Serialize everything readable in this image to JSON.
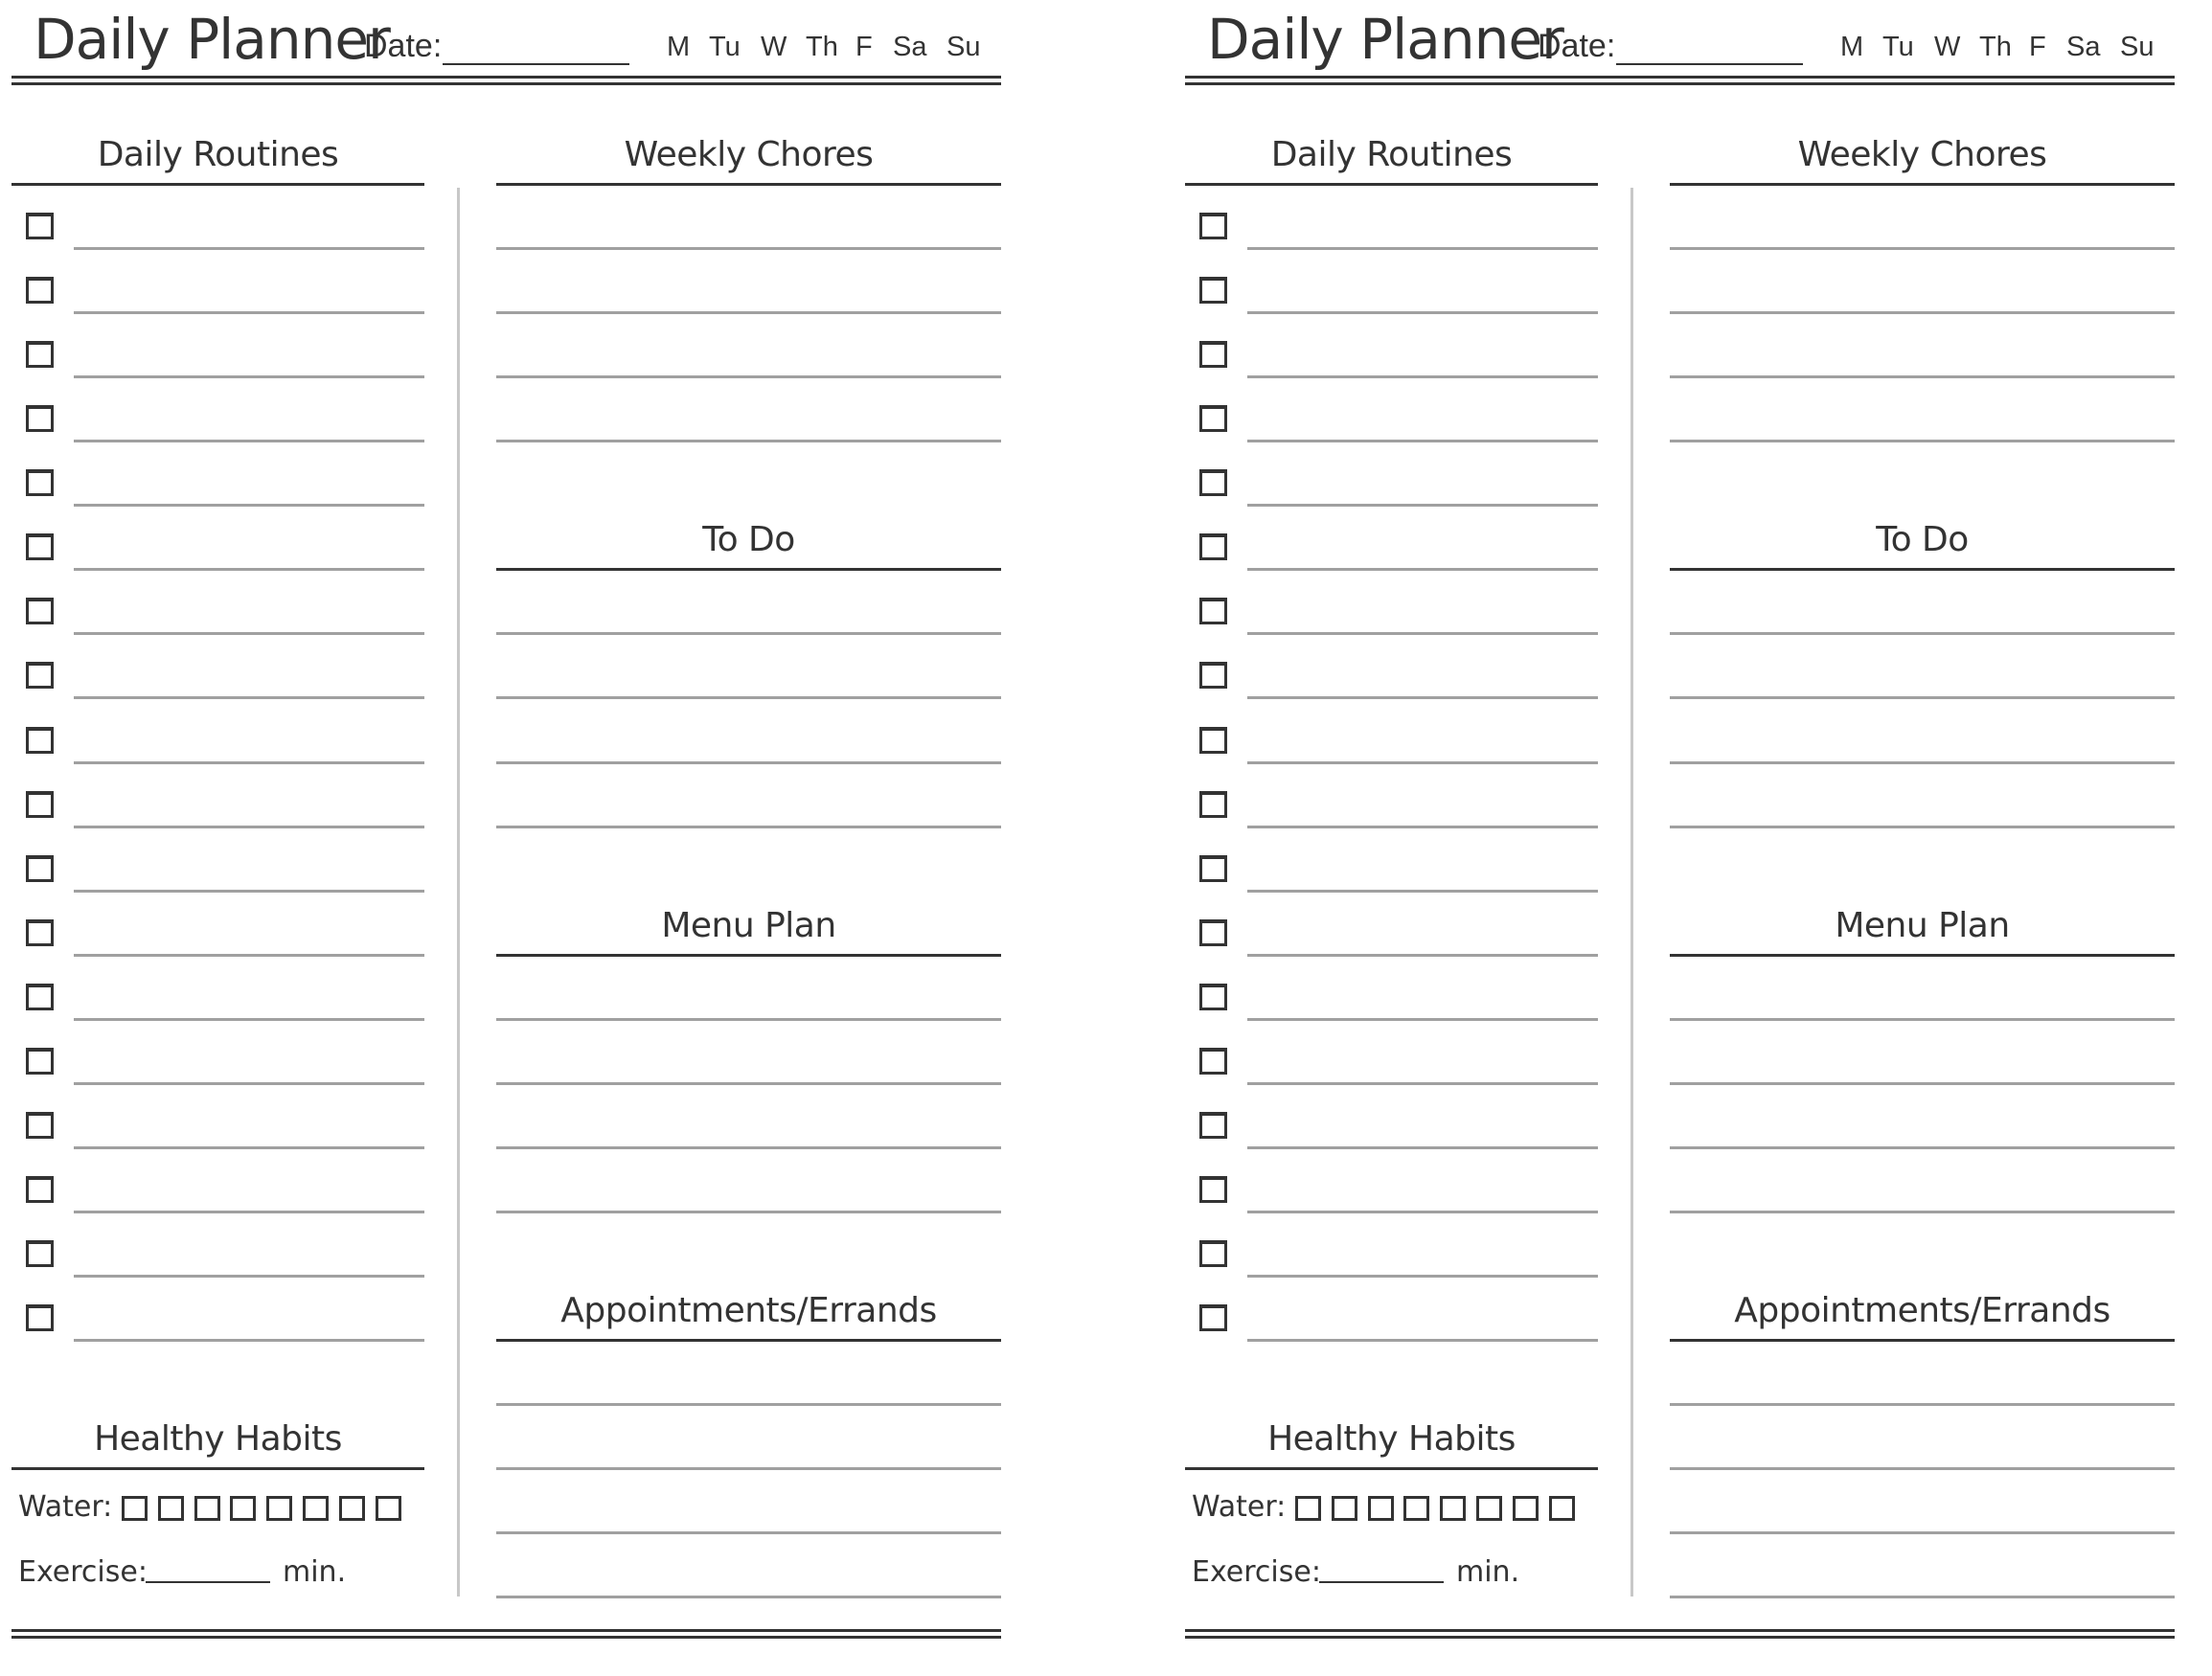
{
  "document": {
    "panels": [
      {
        "title": "Daily Planner",
        "date_label": "Date:",
        "date_value": "",
        "days": [
          "M",
          "Tu",
          "W",
          "Th",
          "F",
          "Sa",
          "Su"
        ],
        "left_column": {
          "heading": "Daily Routines",
          "checkbox_rows": 18,
          "healthy_habits": {
            "heading": "Healthy Habits",
            "water_label": "Water:",
            "water_boxes": 8,
            "exercise_label": "Exercise:",
            "exercise_value": "",
            "exercise_unit": "min."
          }
        },
        "right_column": {
          "sections": [
            {
              "heading": "Weekly Chores",
              "lines": 4
            },
            {
              "heading": "To Do",
              "lines": 4
            },
            {
              "heading": "Menu Plan",
              "lines": 4
            },
            {
              "heading": "Appointments/Errands",
              "lines": 4
            }
          ]
        }
      },
      {
        "title": "Daily Planner",
        "date_label": "Date:",
        "date_value": "",
        "days": [
          "M",
          "Tu",
          "W",
          "Th",
          "F",
          "Sa",
          "Su"
        ],
        "left_column": {
          "heading": "Daily Routines",
          "checkbox_rows": 18,
          "healthy_habits": {
            "heading": "Healthy Habits",
            "water_label": "Water:",
            "water_boxes": 8,
            "exercise_label": "Exercise:",
            "exercise_value": "",
            "exercise_unit": "min."
          }
        },
        "right_column": {
          "sections": [
            {
              "heading": "Weekly Chores",
              "lines": 4
            },
            {
              "heading": "To Do",
              "lines": 4
            },
            {
              "heading": "Menu Plan",
              "lines": 4
            },
            {
              "heading": "Appointments/Errands",
              "lines": 4
            }
          ]
        }
      }
    ]
  },
  "colors": {
    "ink": "#333333",
    "rule": "#a0a0a0",
    "divider": "#c8c8c8",
    "paper": "#ffffff"
  }
}
